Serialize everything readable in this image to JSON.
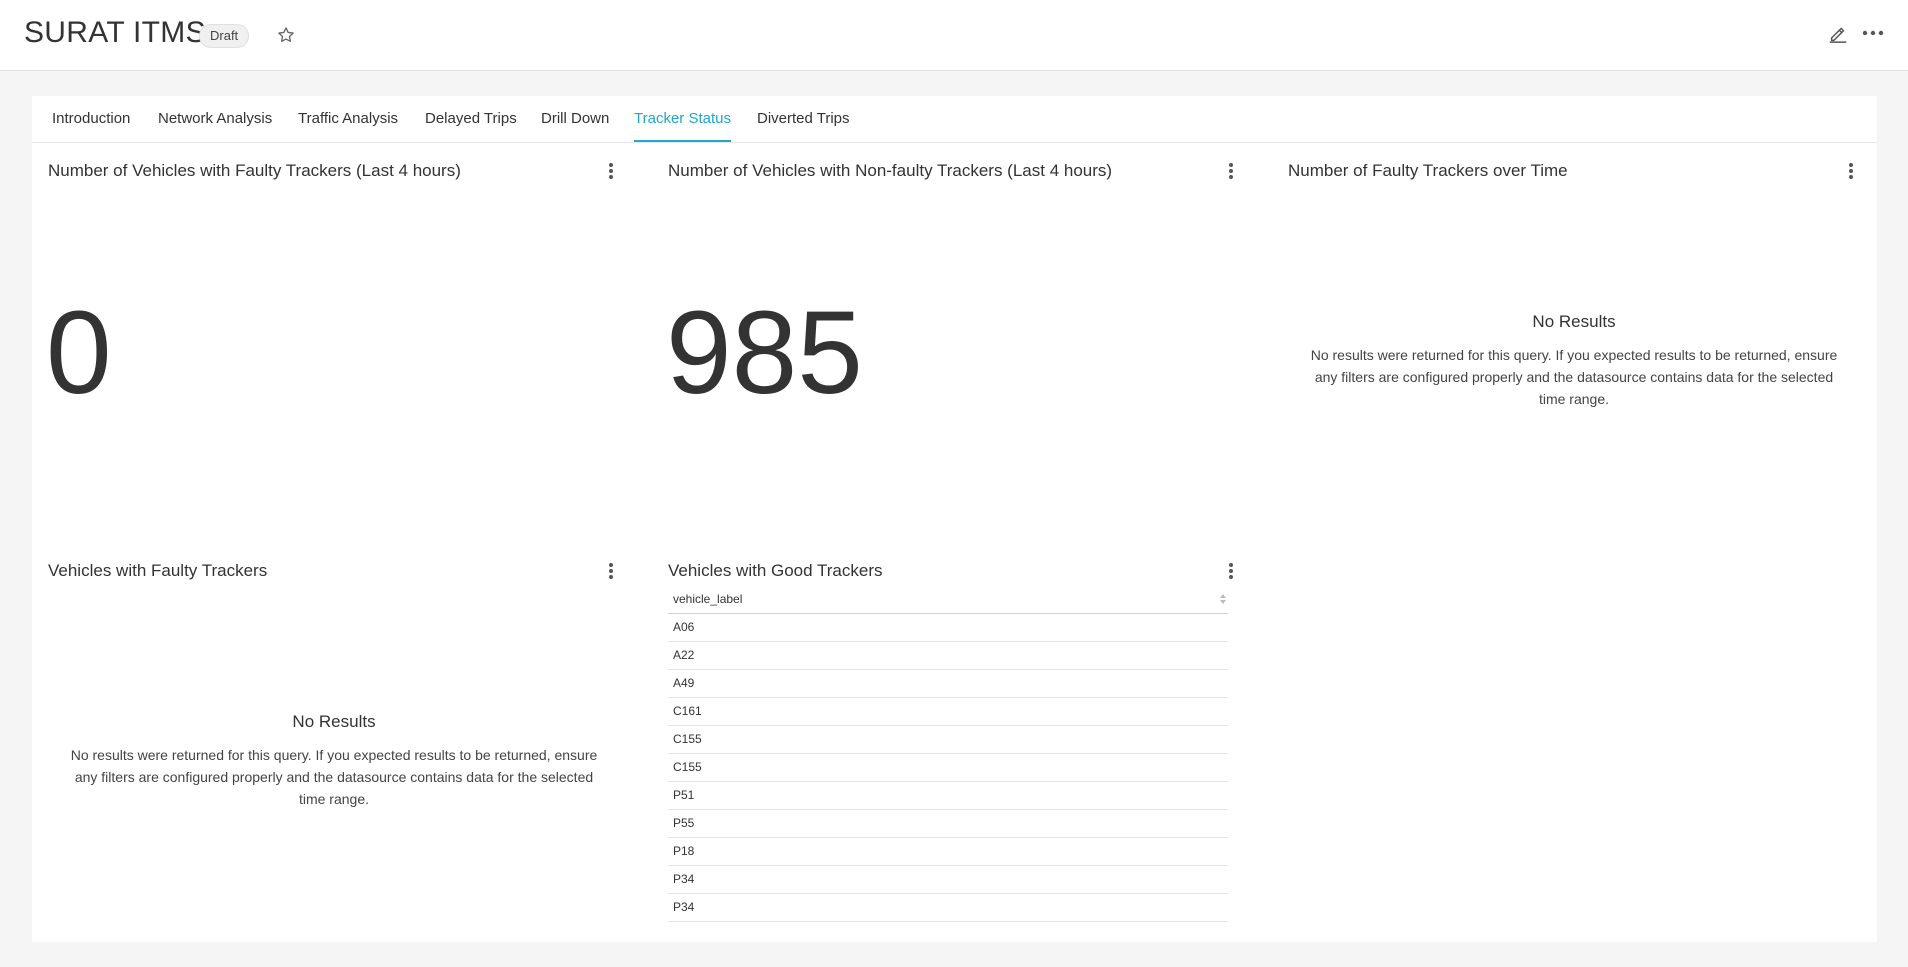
{
  "header": {
    "title": "SURAT ITMS",
    "status_badge": "Draft",
    "icons": [
      "star-icon",
      "edit-icon",
      "more-horizontal-icon"
    ]
  },
  "tabs": [
    {
      "label": "Introduction",
      "active": false
    },
    {
      "label": "Network Analysis",
      "active": false
    },
    {
      "label": "Traffic Analysis",
      "active": false
    },
    {
      "label": "Delayed Trips",
      "active": false
    },
    {
      "label": "Drill Down",
      "active": false
    },
    {
      "label": "Tracker Status",
      "active": true
    },
    {
      "label": "Diverted Trips",
      "active": false
    }
  ],
  "panels": {
    "faulty_count": {
      "title": "Number of Vehicles with Faulty Trackers (Last 4 hours)",
      "value": "0"
    },
    "nonfaulty_count": {
      "title": "Number of Vehicles with Non-faulty Trackers (Last 4 hours)",
      "value": "985"
    },
    "faulty_over_time": {
      "title": "Number of Faulty Trackers over Time",
      "no_results_title": "No Results",
      "no_results_text": "No results were returned for this query. If you expected results to be returned, ensure any filters are configured properly and the datasource contains data for the selected time range."
    },
    "faulty_vehicles": {
      "title": "Vehicles with Faulty Trackers",
      "no_results_title": "No Results",
      "no_results_text": "No results were returned for this query. If you expected results to be returned, ensure any filters are configured properly and the datasource contains data for the selected time range."
    },
    "good_vehicles": {
      "title": "Vehicles with Good Trackers",
      "column": "vehicle_label",
      "rows": [
        "A06",
        "A22",
        "A49",
        "C161",
        "C155",
        "C155",
        "P51",
        "P55",
        "P18",
        "P34",
        "P34"
      ]
    }
  },
  "colors": {
    "accent": "#20a7c9",
    "background": "#f5f5f5",
    "panel": "#ffffff"
  }
}
